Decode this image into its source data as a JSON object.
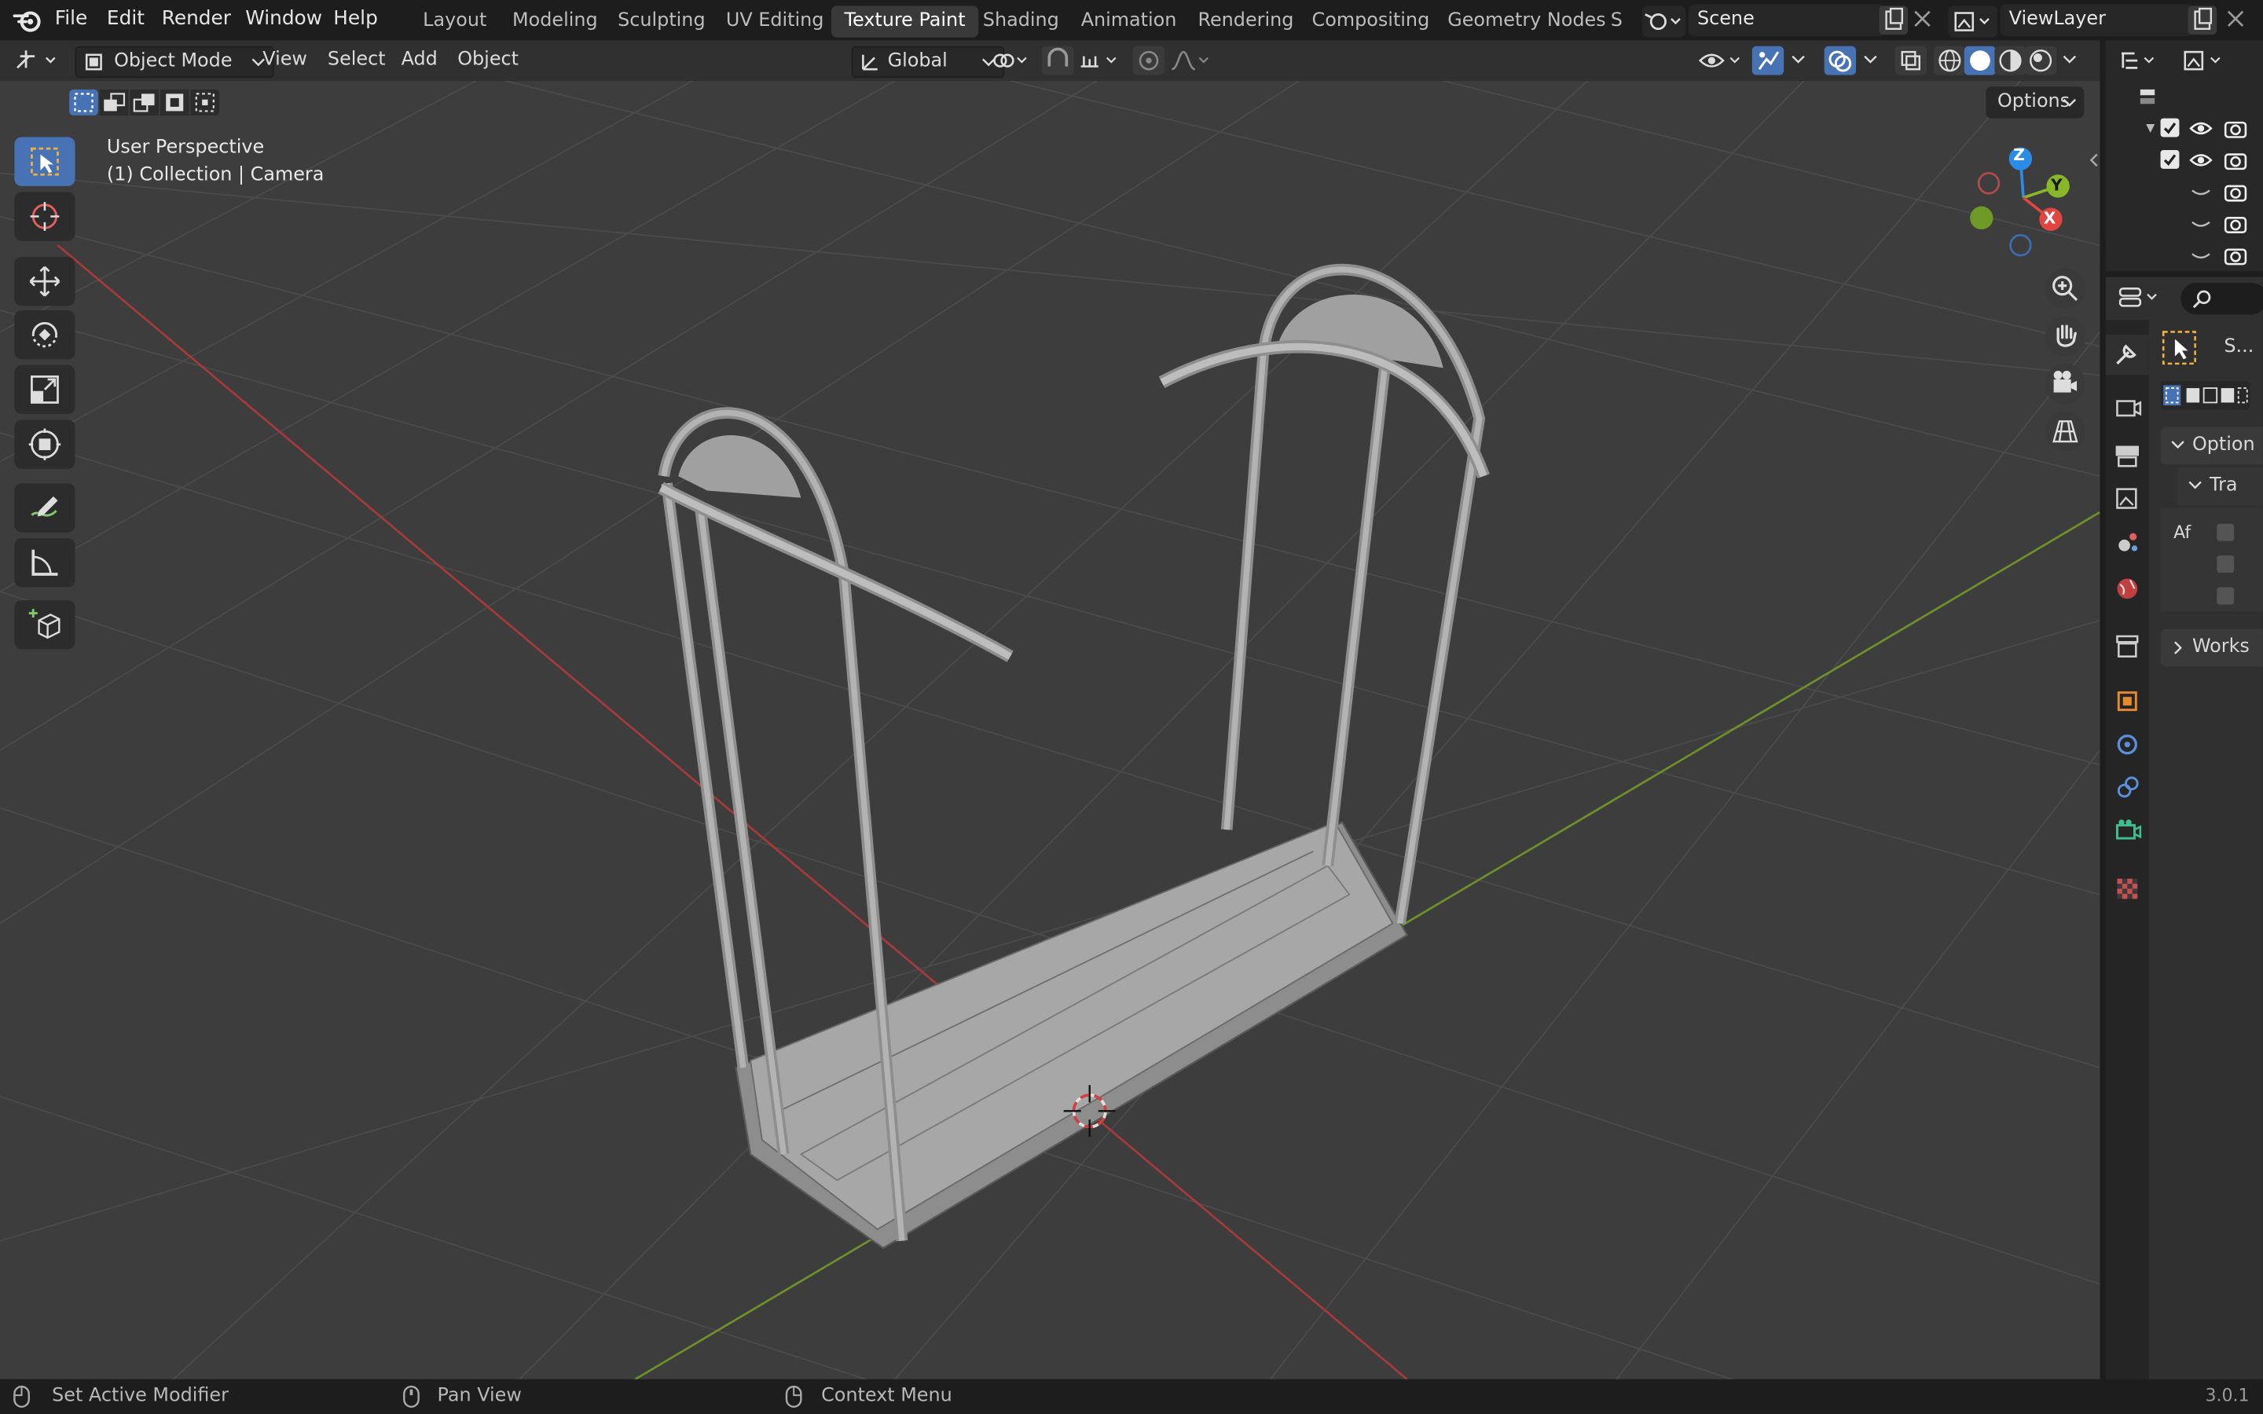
{
  "topbar": {
    "menus": [
      "File",
      "Edit",
      "Render",
      "Window",
      "Help"
    ],
    "workspaces": [
      "Layout",
      "Modeling",
      "Sculpting",
      "UV Editing",
      "Texture Paint",
      "Shading",
      "Animation",
      "Rendering",
      "Compositing",
      "Geometry Nodes",
      "S"
    ],
    "active_workspace": "Texture Paint",
    "scene": "Scene",
    "view_layer": "ViewLayer"
  },
  "viewport_header": {
    "mode": "Object Mode",
    "menus": [
      "View",
      "Select",
      "Add",
      "Object"
    ],
    "transform_orientation": "Global",
    "options_label": "Options"
  },
  "viewport": {
    "view_name": "User Perspective",
    "collection_info": "(1) Collection | Camera",
    "gizmo_axes": {
      "x": "X",
      "y": "Y",
      "z": "Z"
    }
  },
  "properties": {
    "tool_label": "S...",
    "options_label": "Option",
    "transform_label": "Tra",
    "affect_label": "Af",
    "workspace_label": "Works"
  },
  "statusbar": {
    "left": "Set Active Modifier",
    "middle": "Pan View",
    "right": "Context Menu",
    "version": "3.0.1"
  },
  "colors": {
    "accent": "#4772b3",
    "x_axis": "#e1453f",
    "y_axis": "#88b82a",
    "z_axis": "#2b8ce6",
    "viewport_bg": "#3d3d3d"
  }
}
